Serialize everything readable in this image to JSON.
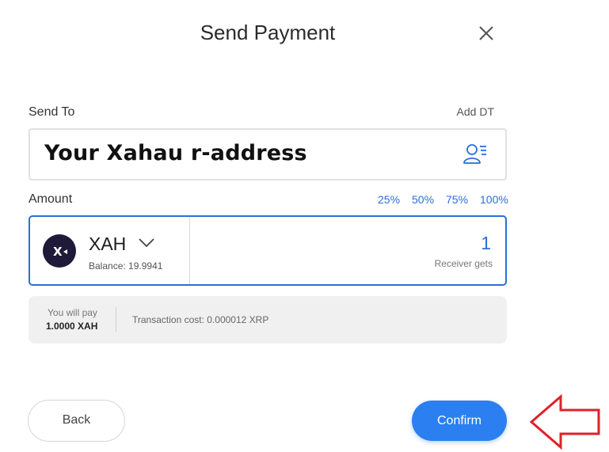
{
  "header": {
    "title": "Send Payment"
  },
  "send_to": {
    "label": "Send To",
    "add_dt_label": "Add DT",
    "address_value": "Your Xahau r-address"
  },
  "amount": {
    "label": "Amount",
    "percent_options": [
      "25%",
      "50%",
      "75%",
      "100%"
    ],
    "token": {
      "symbol": "XAH",
      "balance_text": "Balance: 19.9941",
      "logo_text": "X"
    },
    "value": "1",
    "receiver_label": "Receiver gets"
  },
  "summary": {
    "pay_label": "You will pay",
    "pay_value": "1.0000 XAH",
    "transaction_cost": "Transaction cost: 0.000012 XRP"
  },
  "actions": {
    "back_label": "Back",
    "confirm_label": "Confirm"
  },
  "icons": {
    "close": "close-icon",
    "contacts": "contacts-icon",
    "chevron": "chevron-down-icon",
    "annotation": "red-arrow-icon"
  },
  "colors": {
    "accent": "#2b7ff0",
    "link_blue": "#2a6fd8",
    "annotation_red": "#e0202a",
    "summary_bg": "#f0f0f0"
  }
}
